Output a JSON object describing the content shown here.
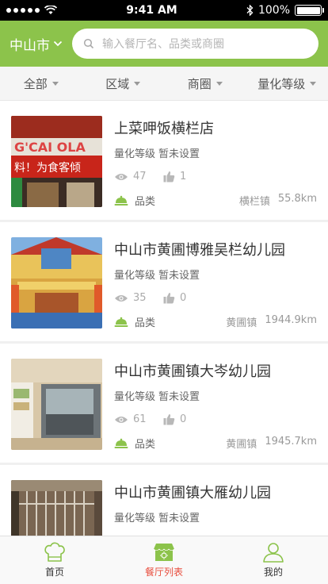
{
  "status_bar": {
    "time": "9:41 AM",
    "battery": "100%",
    "battery_level": 1.0
  },
  "header": {
    "city": "中山市",
    "search_placeholder": "输入餐厅名、品类或商圈"
  },
  "filters": [
    {
      "label": "全部"
    },
    {
      "label": "区域"
    },
    {
      "label": "商圈"
    },
    {
      "label": "量化等级"
    }
  ],
  "restaurants": [
    {
      "name": "上菜呷饭横栏店",
      "grade_label": "量化等级",
      "grade_value": "暂未设置",
      "views": "47",
      "likes": "1",
      "category_label": "品类",
      "area": "横栏镇",
      "distance": "55.8km"
    },
    {
      "name": "中山市黄圃博雅吴栏幼儿园",
      "grade_label": "量化等级",
      "grade_value": "暂未设置",
      "views": "35",
      "likes": "0",
      "category_label": "品类",
      "area": "黄圃镇",
      "distance": "1944.9km"
    },
    {
      "name": "中山市黄圃镇大岑幼儿园",
      "grade_label": "量化等级",
      "grade_value": "暂未设置",
      "views": "61",
      "likes": "0",
      "category_label": "品类",
      "area": "黄圃镇",
      "distance": "1945.7km"
    },
    {
      "name": "中山市黄圃镇大雁幼儿园",
      "grade_label": "量化等级",
      "grade_value": "暂未设置",
      "views": "",
      "likes": "",
      "category_label": "",
      "area": "",
      "distance": ""
    }
  ],
  "tabs": [
    {
      "label": "首页",
      "icon": "chef-hat-icon",
      "active": false
    },
    {
      "label": "餐厅列表",
      "icon": "storefront-icon",
      "active": true
    },
    {
      "label": "我的",
      "icon": "user-icon",
      "active": false
    }
  ],
  "colors": {
    "brand_green": "#8cc34b",
    "active_red": "#e84d3d",
    "text_dark": "#333333",
    "text_muted": "#999999"
  }
}
